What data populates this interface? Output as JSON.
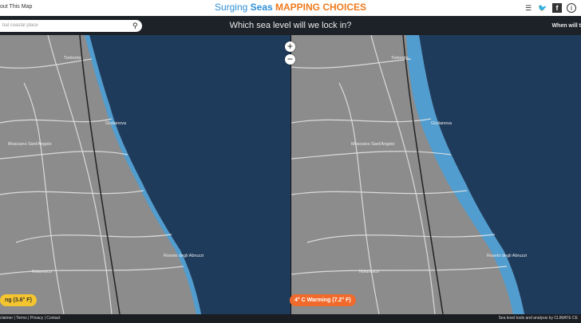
{
  "header": {
    "about_label": "out This Map",
    "brand_part1": "Surging ",
    "brand_part2": "Seas ",
    "brand_part3": "MAPPING CHOICES"
  },
  "search": {
    "placeholder": "bal coastal place"
  },
  "question": "Which sea level will we lock in?",
  "when_label": "When will t",
  "zoom": {
    "in": "+",
    "out": "−"
  },
  "left_map": {
    "warming_label": "ng (3.6° F)",
    "warming_color": "#f5c530"
  },
  "right_map": {
    "warming_label": "4° C Warming (7.2° F)",
    "warming_color": "#f06a2b"
  },
  "places": [
    "Tortoreto",
    "Giulianova",
    "Mosciano Sant'Angelo",
    "Roseto degli Abruzzi",
    "Notaresco"
  ],
  "footer": {
    "links": "claimer | Terms | Privacy | Contact",
    "credit": "Sea level tools and analysis by CLIMATE CE"
  },
  "colors": {
    "land": "#8c8c8c",
    "sea": "#1f3b5c",
    "flood": "#4a9fd6"
  }
}
